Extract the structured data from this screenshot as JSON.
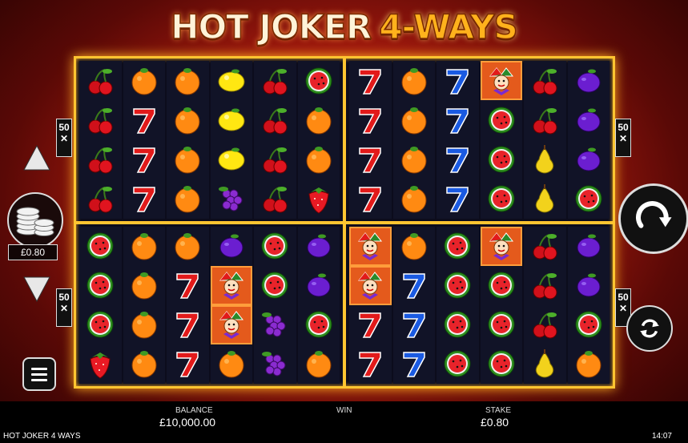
{
  "title": {
    "part1": "HOT JOKER",
    "part2": "4-WAYS"
  },
  "multipliers": {
    "top_left": [
      "50",
      "✕"
    ],
    "top_right": [
      "50",
      "✕"
    ],
    "bottom_left": [
      "50",
      "✕"
    ],
    "bottom_right": [
      "50",
      "✕"
    ]
  },
  "stake_button_value": "£0.80",
  "icons": {
    "up": "triangle-up-icon",
    "down": "triangle-down-icon",
    "coins": "coin-stack-icon",
    "menu": "menu-icon",
    "spin": "spin-arrow-icon",
    "autoplay": "autoplay-icon"
  },
  "grids": [
    [
      [
        "cherry",
        "cherry",
        "cherry",
        "cherry"
      ],
      [
        "orange",
        "seven",
        "seven",
        "seven"
      ],
      [
        "orange",
        "orange",
        "orange",
        "orange"
      ],
      [
        "lemon",
        "lemon",
        "lemon",
        "grape"
      ],
      [
        "cherry",
        "cherry",
        "cherry",
        "cherry"
      ],
      [
        "watermelon",
        "orange",
        "orange",
        "strawberry"
      ]
    ],
    [
      [
        "seven",
        "seven",
        "seven",
        "seven"
      ],
      [
        "orange",
        "orange",
        "orange",
        "orange"
      ],
      [
        "bluseven",
        "bluseven",
        "bluseven",
        "bluseven"
      ],
      [
        "joker",
        "watermelon",
        "watermelon",
        "watermelon"
      ],
      [
        "cherry",
        "cherry",
        "pear",
        "pear"
      ],
      [
        "plum",
        "plum",
        "plum",
        "watermelon"
      ]
    ],
    [
      [
        "watermelon",
        "watermelon",
        "watermelon",
        "strawberry"
      ],
      [
        "orange",
        "orange",
        "orange",
        "orange"
      ],
      [
        "orange",
        "seven",
        "seven",
        "seven"
      ],
      [
        "plum",
        "joker",
        "joker",
        "orange"
      ],
      [
        "watermelon",
        "watermelon",
        "grape",
        "grape"
      ],
      [
        "plum",
        "plum",
        "watermelon",
        "orange"
      ]
    ],
    [
      [
        "joker",
        "joker",
        "seven",
        "seven"
      ],
      [
        "orange",
        "bluseven",
        "bluseven",
        "bluseven"
      ],
      [
        "watermelon",
        "watermelon",
        "watermelon",
        "watermelon"
      ],
      [
        "joker",
        "watermelon",
        "watermelon",
        "watermelon"
      ],
      [
        "cherry",
        "cherry",
        "cherry",
        "pear"
      ],
      [
        "plum",
        "plum",
        "watermelon",
        "orange"
      ]
    ]
  ],
  "bottom_bar": {
    "balance_label": "BALANCE",
    "balance_value": "£10,000.00",
    "win_label": "WIN",
    "stake_label": "STAKE",
    "stake_value": "£0.80",
    "game_name": "HOT JOKER 4 WAYS",
    "clock": "14:07"
  },
  "colors": {
    "frame": "#ffc531",
    "background": "#b51d10",
    "bottom_bar": "#000000"
  }
}
